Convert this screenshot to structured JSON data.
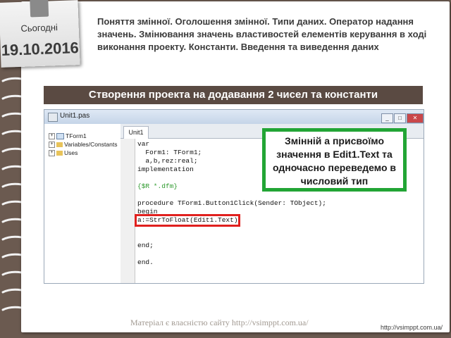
{
  "date_card": {
    "today_label": "Сьогодні",
    "date": "19.10.2016"
  },
  "title": "Поняття змінної. Оголошення змінної. Типи даних. Оператор надання значень. Змінювання значень властивостей елементів керування в ході виконання проекту. Константи. Введення та виведення даних",
  "banner": "Створення проекта на додавання 2 чисел та константи",
  "ide": {
    "window_title": "Unit1.pas",
    "tree": [
      {
        "label": "TForm1",
        "type": "form"
      },
      {
        "label": "Variables/Constants",
        "type": "folder"
      },
      {
        "label": "Uses",
        "type": "folder"
      }
    ],
    "tab": "Unit1",
    "code_lines": [
      {
        "text": "var",
        "kind": "code"
      },
      {
        "text": "  Form1: TForm1;",
        "kind": "code"
      },
      {
        "text": "  a,b,rez:real;",
        "kind": "code"
      },
      {
        "text": "implementation",
        "kind": "code"
      },
      {
        "text": "",
        "kind": "code"
      },
      {
        "text": "{$R *.dfm}",
        "kind": "directive"
      },
      {
        "text": "",
        "kind": "code"
      },
      {
        "text": "procedure TForm1.Button1Click(Sender: TObject);",
        "kind": "code"
      },
      {
        "text": "begin",
        "kind": "code"
      },
      {
        "text": "a:=StrToFloat(Edit1.Text)",
        "kind": "code"
      },
      {
        "text": "",
        "kind": "code"
      },
      {
        "text": "",
        "kind": "code"
      },
      {
        "text": "end;",
        "kind": "code"
      },
      {
        "text": "",
        "kind": "code"
      },
      {
        "text": "end.",
        "kind": "code"
      }
    ]
  },
  "callout": "Змінній а присвоїмо значення в Edit1.Text та одночасно переведемо в числовий тип",
  "footer": {
    "watermark": "Матеріал є власністю сайту http://vsimppt.com.ua/",
    "url": "http://vsimppt.com.ua/"
  },
  "colors": {
    "banner_bg": "#5a4a42",
    "callout_border": "#22a535",
    "highlight_border": "#e0201e"
  }
}
